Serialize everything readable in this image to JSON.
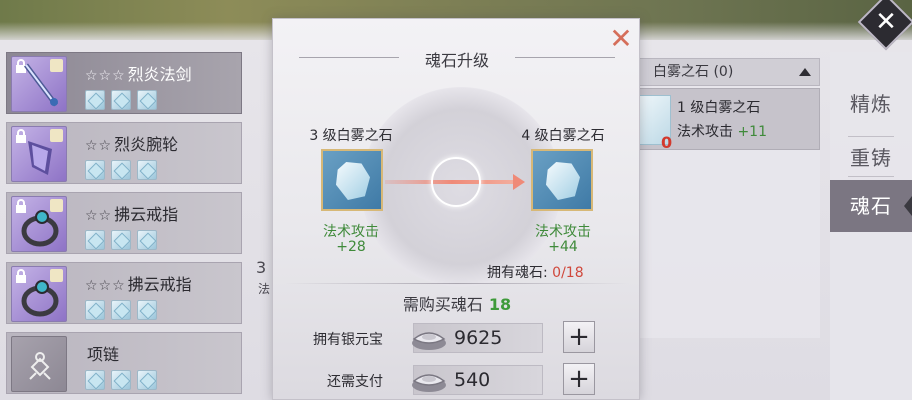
{
  "modal": {
    "title": "魂石升级",
    "from_stone": {
      "name": "3 级白雾之石",
      "stat_name": "法术攻击",
      "stat_value": "+28"
    },
    "to_stone": {
      "name": "4 级白雾之石",
      "stat_name": "法术攻击",
      "stat_value": "+44"
    },
    "owned_label": "拥有魂石:",
    "owned_value": "0/18",
    "need_label": "需购买魂石",
    "need_value": "18",
    "currencies": [
      {
        "label": "拥有银元宝",
        "value": "9625"
      },
      {
        "label": "还需支付",
        "value": "540"
      }
    ],
    "plus_glyph": "+"
  },
  "items": [
    {
      "stars": "☆☆☆",
      "name": "烈炎法剑"
    },
    {
      "stars": "☆☆",
      "name": "烈炎腕轮"
    },
    {
      "stars": "☆☆",
      "name": "拂云戒指"
    },
    {
      "stars": "☆☆☆",
      "name": "拂云戒指"
    },
    {
      "stars": "",
      "name": "项链"
    }
  ],
  "right_panel": {
    "header": "白雾之石 (0)",
    "row_name": "1 级白雾之石",
    "row_stat": "法术攻击",
    "row_stat_value": "+11",
    "row_count": "0"
  },
  "tabs": [
    "精炼",
    "重铸",
    "魂石"
  ],
  "active_tab": "魂石",
  "background_fragments": [
    "3",
    "法"
  ],
  "colors": {
    "stat_green": "#3f8a3a",
    "owned_red": "#d0483c",
    "beam": "#ef8a78",
    "stone_border": "#d7b877"
  }
}
